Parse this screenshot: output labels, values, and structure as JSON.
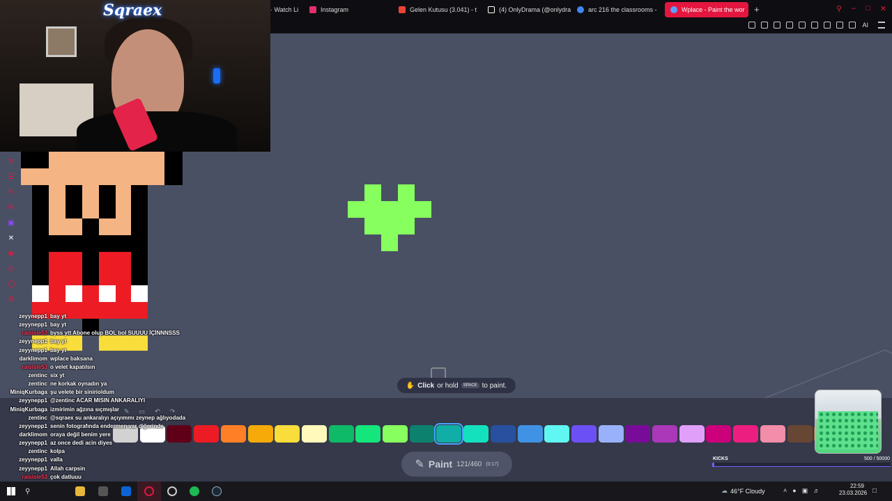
{
  "browser": {
    "tabs": [
      {
        "label": "· Watch Li",
        "icon": "tv-icon",
        "color": "#888888"
      },
      {
        "label": "Instagram",
        "icon": "instagram-icon",
        "color": "#e1306c"
      },
      {
        "label": "Gelen Kutusu (3.041) - top",
        "icon": "gmail-icon",
        "color": "#ea4335"
      },
      {
        "label": "(4) OnlyDrama (@onlydra",
        "icon": "x-icon",
        "color": "#ffffff"
      },
      {
        "label": "arc 216 the classrooms - G",
        "icon": "google-icon",
        "color": "#4285f4"
      },
      {
        "label": "Wplace - Paint the wor",
        "icon": "wplace-icon",
        "color": "#5aa0ff",
        "active": true
      }
    ],
    "new_tab": "+",
    "ai_label": "AI"
  },
  "webcam": {
    "logo_text": "Sqraex"
  },
  "canvas": {
    "tooltip": {
      "click": "Click",
      "middle": "or hold",
      "key": "SPACE",
      "end": "to paint."
    }
  },
  "chat": [
    {
      "user": "zeyynepp1",
      "text": "bay yt",
      "color": "#ffffff"
    },
    {
      "user": "zeyynepp1",
      "text": "bay yt",
      "color": "#ffffff"
    },
    {
      "user": "raisisle53",
      "text": "byss ytt Abone olup BOL bol SUUUU İÇİNNNSSS",
      "color": "#ff3a5c"
    },
    {
      "user": "zeyynepp1",
      "text": "bay yt",
      "color": "#ffffff"
    },
    {
      "user": "zeyynepp1",
      "text": "bay yt",
      "color": "#ffffff"
    },
    {
      "user": "darklimom",
      "text": "wplace baksana",
      "color": "#ffffff"
    },
    {
      "user": "raisisle53",
      "text": "o velet kapatılsın",
      "color": "#ff3a5c"
    },
    {
      "user": "zentinc",
      "text": "six yt",
      "color": "#ffffff"
    },
    {
      "user": "zentinc",
      "text": "ne korkak oynadın ya",
      "color": "#ffffff"
    },
    {
      "user": "MiniqKurbaga",
      "text": "şu velete bir sinirioldum",
      "color": "#ffffff"
    },
    {
      "user": "zeyynepp1",
      "text": "@zentinc ACAR MISIN ANKARALIYI",
      "color": "#ffffff"
    },
    {
      "user": "MiniqKurbaga",
      "text": "izmirimin ağzına sıçmışlar",
      "color": "#ffffff"
    },
    {
      "user": "zentinc",
      "text": "@sqraex su ankaralıyı açıyımmı zeynep ağlıyodada",
      "color": "#ffffff"
    },
    {
      "user": "zeyynepp1",
      "text": "senin fotografında endermen var diğerinde",
      "color": "#ffffff"
    },
    {
      "user": "darklimom",
      "text": "oraya değil benim yere",
      "color": "#ffffff"
    },
    {
      "user": "zeyynepp1",
      "text": "az once dedi acin diyes",
      "color": "#ffffff"
    },
    {
      "user": "zentinc",
      "text": "kolpa",
      "color": "#ffffff"
    },
    {
      "user": "zeyynepp1",
      "text": "valla",
      "color": "#ffffff"
    },
    {
      "user": "zeyynepp1",
      "text": "Allah carpsin",
      "color": "#ffffff"
    },
    {
      "user": "raisisle53",
      "text": "çok datluuu",
      "color": "#ff3a5c"
    },
    {
      "user": "zentinc",
      "text": "açıyom lanet glesin.",
      "color": "#ffffff"
    },
    {
      "user": "zeyynepp1",
      "text": "hehehe",
      "color": "#ffffff"
    }
  ],
  "palette": [
    {
      "name": "light-gray",
      "color": "#d2d2d2"
    },
    {
      "name": "white",
      "color": "#ffffff"
    },
    {
      "name": "deep-red",
      "color": "#600018"
    },
    {
      "name": "red",
      "color": "#ed1c24"
    },
    {
      "name": "orange",
      "color": "#ff7f27"
    },
    {
      "name": "gold",
      "color": "#f6aa09"
    },
    {
      "name": "yellow",
      "color": "#f9dd3b"
    },
    {
      "name": "light-yellow",
      "color": "#fffabc"
    },
    {
      "name": "dark-green",
      "color": "#0eb968"
    },
    {
      "name": "green",
      "color": "#13e67b"
    },
    {
      "name": "light-green",
      "color": "#87ff5e"
    },
    {
      "name": "dark-teal",
      "color": "#0c816e"
    },
    {
      "name": "teal",
      "color": "#10aea6",
      "selected": true
    },
    {
      "name": "light-teal",
      "color": "#13e1be"
    },
    {
      "name": "dark-blue",
      "color": "#28509e"
    },
    {
      "name": "blue",
      "color": "#4093e4"
    },
    {
      "name": "cyan",
      "color": "#60f7f2"
    },
    {
      "name": "indigo",
      "color": "#6b50f6"
    },
    {
      "name": "light-indigo",
      "color": "#99b1fb"
    },
    {
      "name": "dark-purple",
      "color": "#780c99"
    },
    {
      "name": "purple",
      "color": "#aa38b9"
    },
    {
      "name": "light-purple",
      "color": "#e09ff9"
    },
    {
      "name": "dark-pink",
      "color": "#cb007a"
    },
    {
      "name": "pink",
      "color": "#ec1f80"
    },
    {
      "name": "light-pink",
      "color": "#f38da9"
    },
    {
      "name": "dark-brown",
      "color": "#684634"
    },
    {
      "name": "brown",
      "color": "#95682a"
    }
  ],
  "paint": {
    "label": "Paint",
    "count": "121/460",
    "timer": "(0:17)"
  },
  "kicks": {
    "label": "KICKS",
    "count": "500 / 50000",
    "progress": 0.01
  },
  "taskbar": {
    "weather": "46°F  Cloudy",
    "time": "22:59",
    "date": "23.03.2026"
  }
}
